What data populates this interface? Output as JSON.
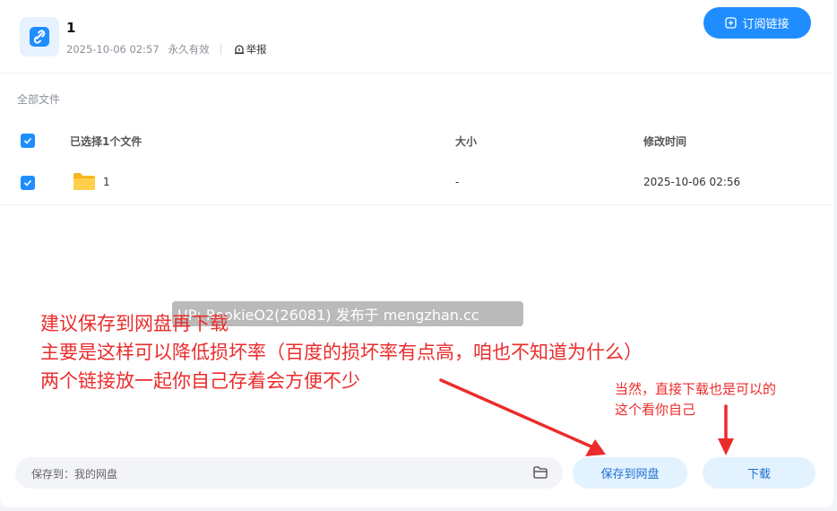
{
  "header": {
    "title": "1",
    "created_at": "2025-10-06 02:57",
    "validity": "永久有效",
    "report_label": "举报",
    "subscribe_label": "订阅链接"
  },
  "breadcrumb": "全部文件",
  "table": {
    "headers": {
      "name": "已选择1个文件",
      "size": "大小",
      "modified": "修改时间"
    },
    "rows": [
      {
        "name": "1",
        "size": "-",
        "modified": "2025-10-06 02:56",
        "checked": true,
        "icon": "folder-icon"
      }
    ]
  },
  "watermark": "UP: RookieO2(26081) 发布于 mengzhan.cc",
  "annotations": {
    "main": [
      "建议保存到网盘再下载",
      "主要是这样可以降低损坏率（百度的损坏率有点高，咱也不知道为什么）",
      "两个链接放一起你自己存着会方便不少"
    ],
    "side": [
      "当然，直接下载也是可以的",
      "这个看你自己"
    ],
    "color": "#ea2c2c"
  },
  "footer": {
    "save_path_label": "保存到：我的网盘",
    "save_button": "保存到网盘",
    "download_button": "下载"
  },
  "colors": {
    "accent": "#1f8dff",
    "pill_bg": "#e3f2ff"
  }
}
